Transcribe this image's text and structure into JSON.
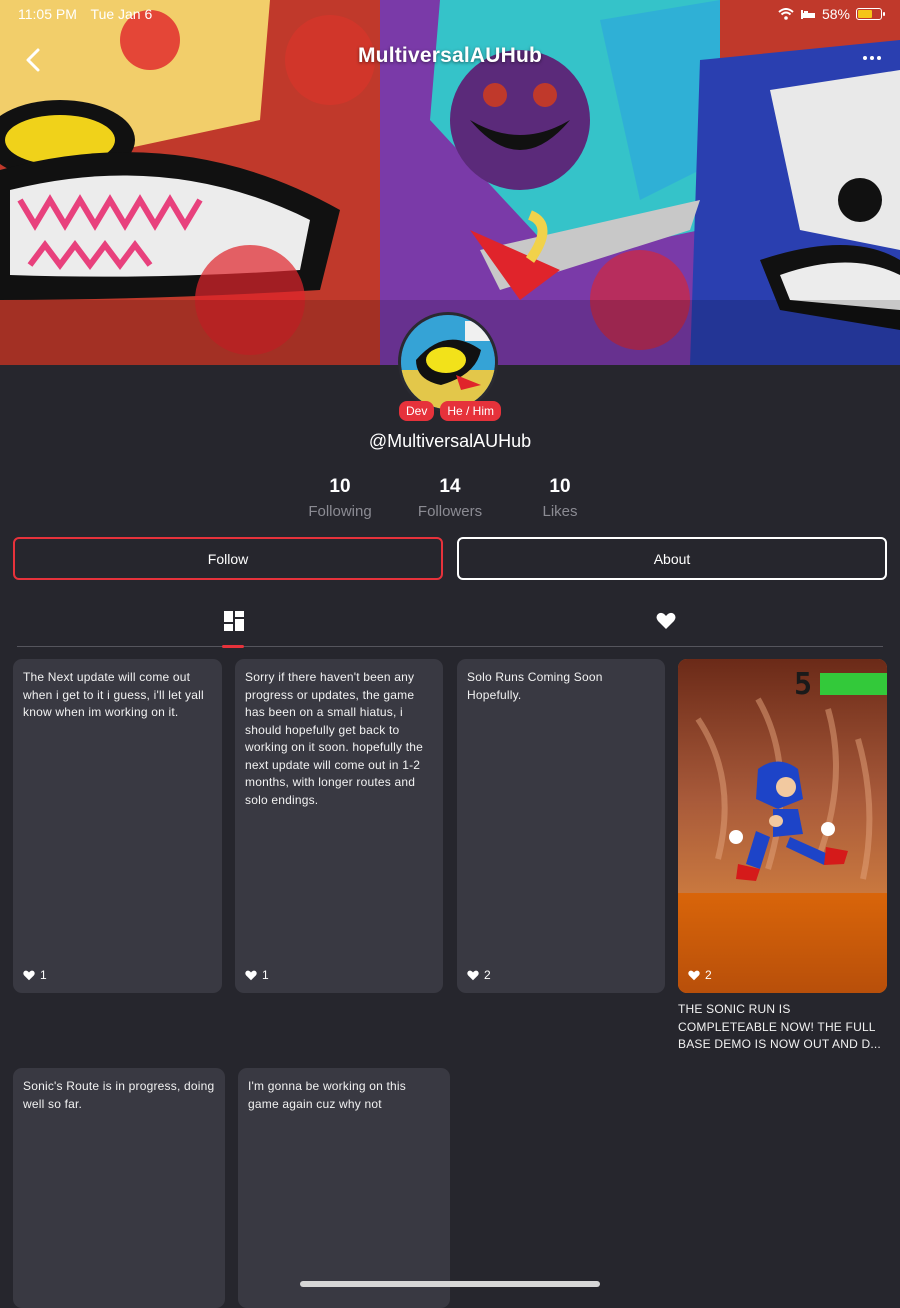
{
  "status_bar": {
    "time": "11:05 PM",
    "date": "Tue Jan 6",
    "battery": "58%",
    "battery_level": 0.58
  },
  "header": {
    "title": "MultiversalAUHub"
  },
  "profile": {
    "badges": [
      "Dev",
      "He / Him"
    ],
    "handle": "@MultiversalAUHub",
    "stats": [
      {
        "value": "10",
        "label": "Following"
      },
      {
        "value": "14",
        "label": "Followers"
      },
      {
        "value": "10",
        "label": "Likes"
      }
    ],
    "follow_label": "Follow",
    "about_label": "About"
  },
  "tabs": {
    "posts_icon": "grid-icon",
    "likes_icon": "heart-icon"
  },
  "posts": [
    {
      "text": "The Next update will come out when i get to it i guess, i'll let yall know when im working on it.",
      "likes": "1"
    },
    {
      "text": "Sorry if there haven't been any progress or updates, the game has been on a small hiatus, i should hopefully get back to working on it soon. hopefully the next update will come out in 1-2 months, with longer routes and solo endings.",
      "likes": "1"
    },
    {
      "text": "Solo Runs Coming Soon Hopefully.",
      "likes": "2"
    },
    {
      "text": "",
      "likes": "2",
      "caption": "THE SONIC RUN IS COMPLETEABLE NOW! THE FULL BASE DEMO IS NOW OUT AND D...",
      "image_counter": "5"
    },
    {
      "text": "Sonic's Route is in progress, doing well so far.",
      "likes": ""
    },
    {
      "text": "I'm gonna be working on this game again cuz why not",
      "likes": ""
    }
  ]
}
